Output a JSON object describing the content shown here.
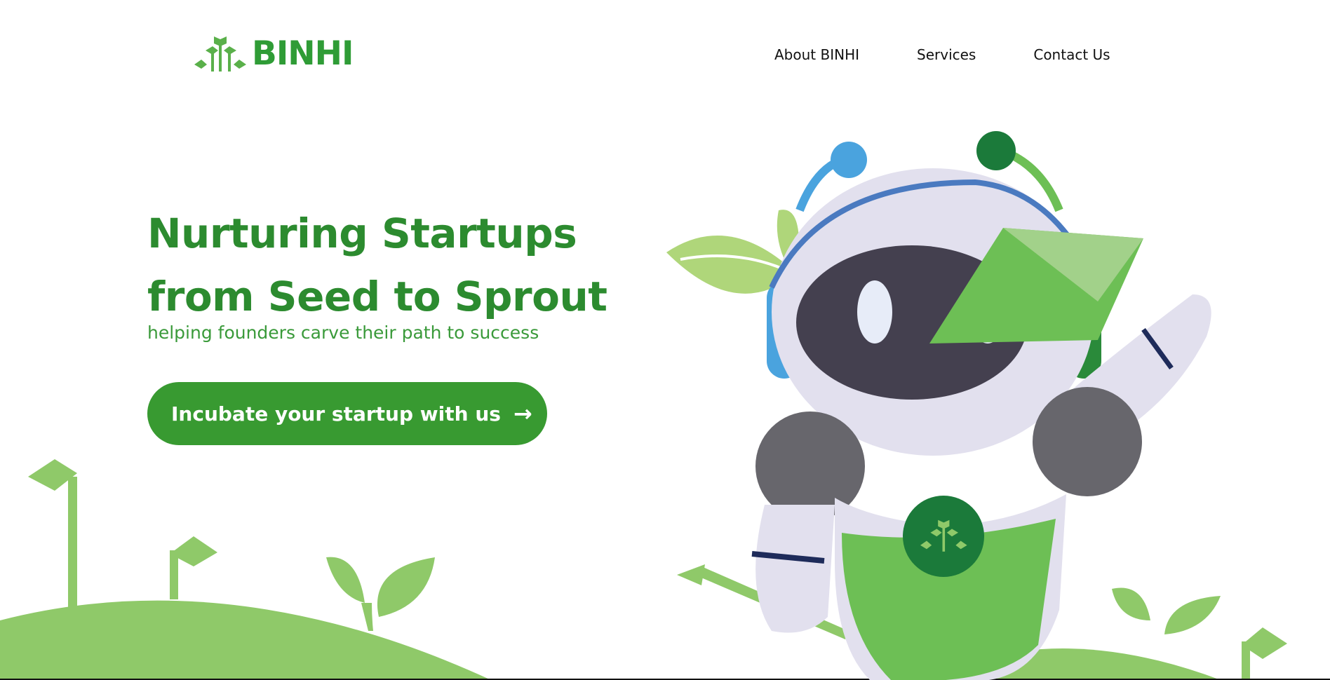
{
  "brand": {
    "name": "BINHI"
  },
  "nav": {
    "items": [
      {
        "label": "About BINHI"
      },
      {
        "label": "Services"
      },
      {
        "label": "Contact Us"
      }
    ]
  },
  "hero": {
    "title_line1": "Nurturing Startups",
    "title_line2": "from Seed to Sprout",
    "subtitle": "helping founders carve their path to success",
    "cta_label": "Incubate your startup with us",
    "cta_icon": "arrow-right-icon"
  },
  "colors": {
    "brand_green": "#2f9c36",
    "cta_green": "#389a31",
    "light_green": "#8fc969",
    "robot_body": "#e2e0ee",
    "robot_face": "#44404f"
  }
}
